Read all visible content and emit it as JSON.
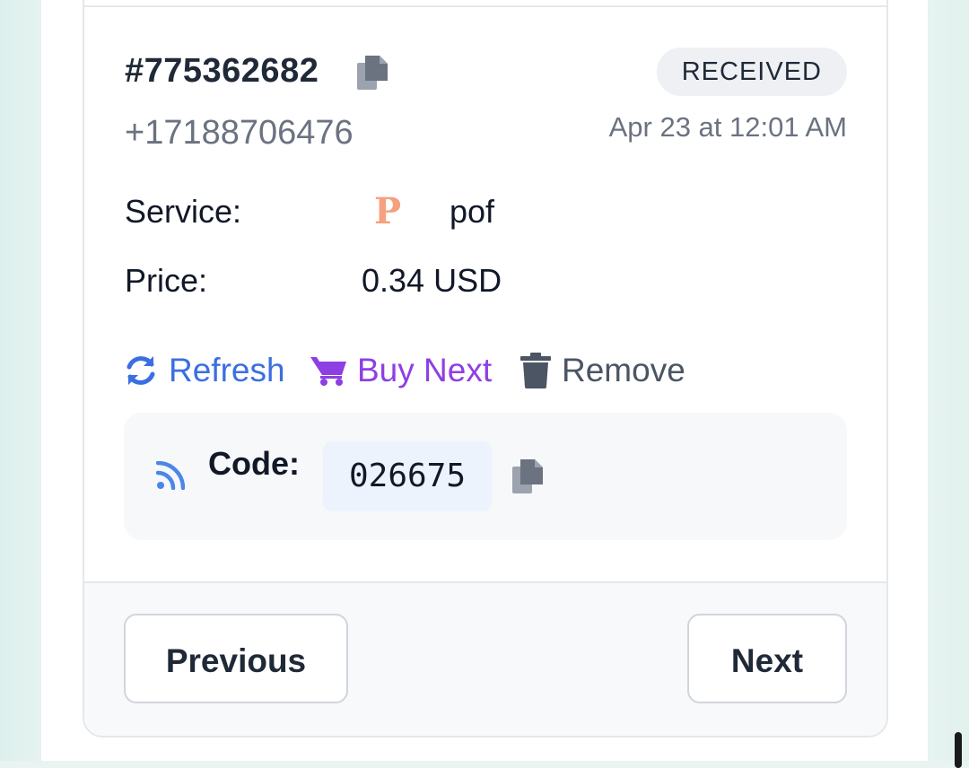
{
  "order": {
    "id": "#775362682",
    "phone": "+17188706476",
    "status": "RECEIVED",
    "date": "Apr 23 at 12:01 AM"
  },
  "details": {
    "service_label": "Service:",
    "service_logo": "P",
    "service_name": "pof",
    "price_label": "Price:",
    "price_value": "0.34 USD"
  },
  "actions": {
    "refresh": "Refresh",
    "buy_next": "Buy Next",
    "remove": "Remove"
  },
  "code": {
    "label": "Code:",
    "value": "026675"
  },
  "pagination": {
    "previous": "Previous",
    "next": "Next"
  },
  "colors": {
    "refresh": "#3b6fe0",
    "buy_next": "#8e3fe4",
    "remove": "#4b5563",
    "service_logo": "#f6a07f",
    "signal_icon": "#4b86e8"
  },
  "icons": [
    "copy-icon",
    "refresh-icon",
    "cart-icon",
    "trash-icon",
    "signal-icon"
  ]
}
